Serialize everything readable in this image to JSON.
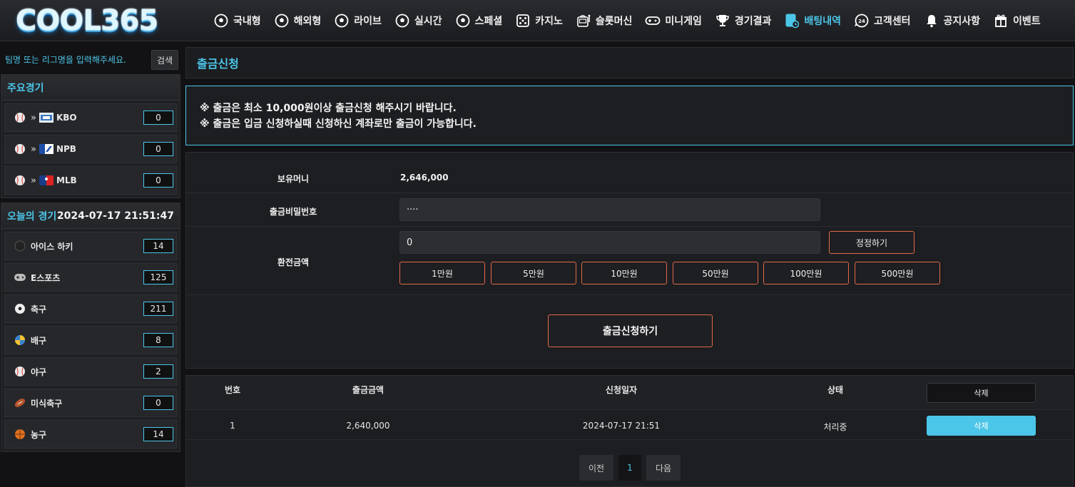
{
  "header": {
    "logo": "COOL365",
    "nav": [
      {
        "label": "국내형",
        "icon": "soccer-ball-icon",
        "active": false
      },
      {
        "label": "해외형",
        "icon": "soccer-ball-icon",
        "active": false
      },
      {
        "label": "라이브",
        "icon": "soccer-ball-icon",
        "active": false
      },
      {
        "label": "실시간",
        "icon": "soccer-ball-icon",
        "active": false
      },
      {
        "label": "스페셜",
        "icon": "soccer-ball-icon",
        "active": false
      },
      {
        "label": "카지노",
        "icon": "dice-icon",
        "active": false
      },
      {
        "label": "슬롯머신",
        "icon": "slot-machine-icon",
        "active": false
      },
      {
        "label": "미니게임",
        "icon": "gamepad-icon",
        "active": false
      },
      {
        "label": "경기결과",
        "icon": "trophy-icon",
        "active": false
      },
      {
        "label": "배팅내역",
        "icon": "betting-history-icon",
        "active": true
      },
      {
        "label": "고객센터",
        "icon": "support-24-icon",
        "active": false
      },
      {
        "label": "공지사항",
        "icon": "bell-icon",
        "active": false
      },
      {
        "label": "이벤트",
        "icon": "gift-icon",
        "active": false
      }
    ]
  },
  "sidebar": {
    "search_placeholder": "팀명 또는 리그명을 입력해주세요.",
    "search_button": "검색",
    "featured": {
      "title": "주요경기",
      "items": [
        {
          "name": "KBO",
          "count": "0"
        },
        {
          "name": "NPB",
          "count": "0"
        },
        {
          "name": "MLB",
          "count": "0"
        }
      ]
    },
    "today": {
      "title": "오늘의 경기",
      "clock": "2024-07-17 21:51:47",
      "items": [
        {
          "name": "아이스 하키",
          "count": "14",
          "icon": "hockey-puck-icon"
        },
        {
          "name": "E스포츠",
          "count": "125",
          "icon": "gamepad-icon"
        },
        {
          "name": "축구",
          "count": "211",
          "icon": "soccer-ball-icon"
        },
        {
          "name": "배구",
          "count": "8",
          "icon": "volleyball-icon"
        },
        {
          "name": "야구",
          "count": "2",
          "icon": "baseball-icon"
        },
        {
          "name": "미식축구",
          "count": "0",
          "icon": "football-icon"
        },
        {
          "name": "농구",
          "count": "14",
          "icon": "basketball-icon"
        }
      ]
    }
  },
  "main": {
    "title": "출금신청",
    "notice": [
      "※ 출금은 최소 10,000원이상 출금신청 해주시기 바랍니다.",
      "※ 출금은 입금 신청하실때 신청하신 계좌로만 출금이 가능합니다."
    ],
    "form": {
      "balance_label": "보유머니",
      "balance_value": "2,646,000",
      "password_label": "출금비밀번호",
      "password_value": "····",
      "amount_label": "환전금액",
      "amount_value": "0",
      "reset_button": "정정하기",
      "quick_amounts": [
        "1만원",
        "5만원",
        "10만원",
        "50만원",
        "100만원",
        "500만원"
      ],
      "submit_button": "출금신청하기"
    },
    "table": {
      "headers": {
        "no": "번호",
        "amount": "출금금액",
        "date": "신청일자",
        "status": "상태",
        "delete": "삭제"
      },
      "rows": [
        {
          "no": "1",
          "amount": "2,640,000",
          "date": "2024-07-17 21:51",
          "status": "처리중",
          "delete": "삭제"
        }
      ]
    },
    "pagination": {
      "prev": "이전",
      "current": "1",
      "next": "다음"
    }
  },
  "colors": {
    "accent": "#4cc6e8",
    "button_border": "#e06a4a",
    "background": "#121214"
  }
}
